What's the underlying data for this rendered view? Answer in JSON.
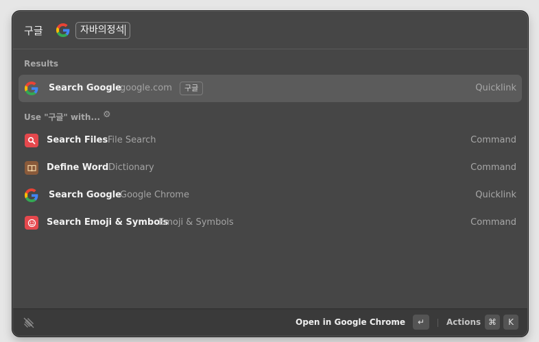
{
  "search": {
    "query_prefix": "구글",
    "argument_value": "자바의정석"
  },
  "results": {
    "section_title": "Results",
    "items": [
      {
        "title": "Search Google",
        "subtitle": "google.com",
        "tag": "구글",
        "type": "Quicklink",
        "icon": "google-icon"
      }
    ]
  },
  "use_with": {
    "section_title": "Use \"구글\" with...",
    "settings_icon": "gear-icon",
    "items": [
      {
        "title": "Search Files",
        "subtitle": "File Search",
        "type": "Command",
        "icon": "magnifier-icon",
        "icon_color": "#e5484d"
      },
      {
        "title": "Define Word",
        "subtitle": "Dictionary",
        "type": "Command",
        "icon": "book-icon",
        "icon_color": "#8a5a3a"
      },
      {
        "title": "Search Google",
        "subtitle": "Google Chrome",
        "type": "Quicklink",
        "icon": "google-icon"
      },
      {
        "title": "Search Emoji & Symbols",
        "subtitle": "Emoji & Symbols",
        "type": "Command",
        "icon": "smiley-icon",
        "icon_color": "#e5484d"
      }
    ]
  },
  "footer": {
    "primary_action": "Open in Google Chrome",
    "enter_key": "↵",
    "actions_label": "Actions",
    "cmd_key": "⌘",
    "k_key": "K"
  },
  "colors": {
    "window_bg": "#464646",
    "selected_row": "#5b5b5b",
    "footer_bg": "#3a3a3a"
  }
}
